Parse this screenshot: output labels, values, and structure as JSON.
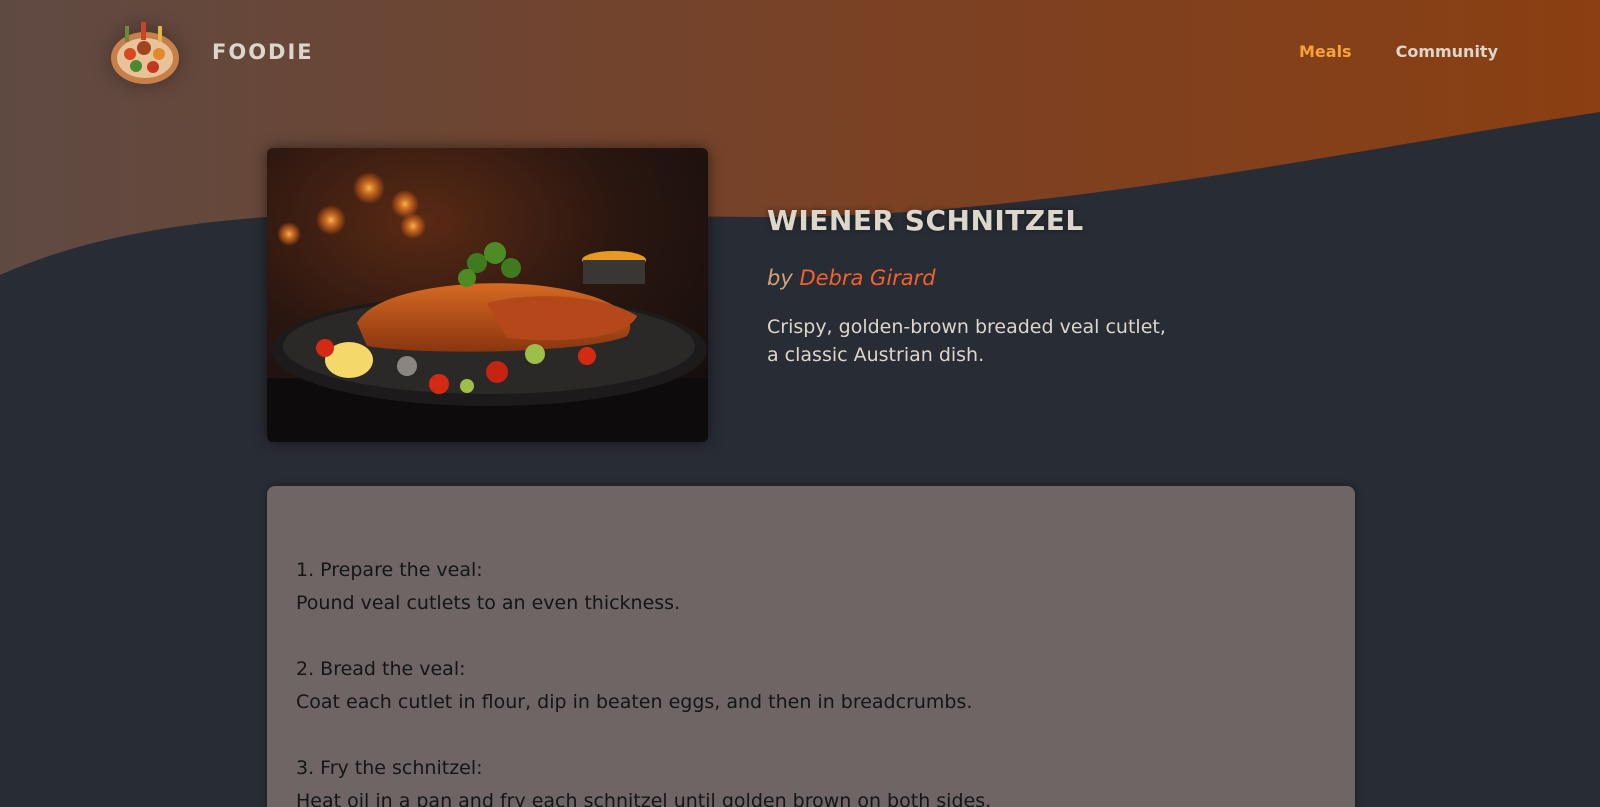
{
  "header": {
    "logo_alt": "A plate with food on it",
    "logo_text": "FOODIE",
    "nav": [
      {
        "label": "Meals",
        "active": true
      },
      {
        "label": "Community",
        "active": false
      }
    ]
  },
  "meal": {
    "image_alt": "Wiener Schnitzel",
    "title": "WIENER SCHNITZEL",
    "by_prefix": "by",
    "creator": "Debra Girard",
    "summary": "Crispy, golden-brown breaded veal cutlet, a classic Austrian dish."
  },
  "instructions": [
    {
      "title": "1. Prepare the veal:",
      "text": "Pound veal cutlets to an even thickness."
    },
    {
      "title": "2. Bread the veal:",
      "text": "Coat each cutlet in flour, dip in beaten eggs, and then in breadcrumbs."
    },
    {
      "title": "3. Fry the schnitzel:",
      "text": "Heat oil in a pan and fry each schnitzel until golden brown on both sides."
    }
  ],
  "colors": {
    "background": "#282c34",
    "header_gradient_start": "#6a4a3a",
    "header_gradient_end": "#8a3f14",
    "nav_active": "#f8a233",
    "creator_link": "#f3622c",
    "instructions_bg": "#6e6564",
    "text": "#ddd6cb"
  }
}
